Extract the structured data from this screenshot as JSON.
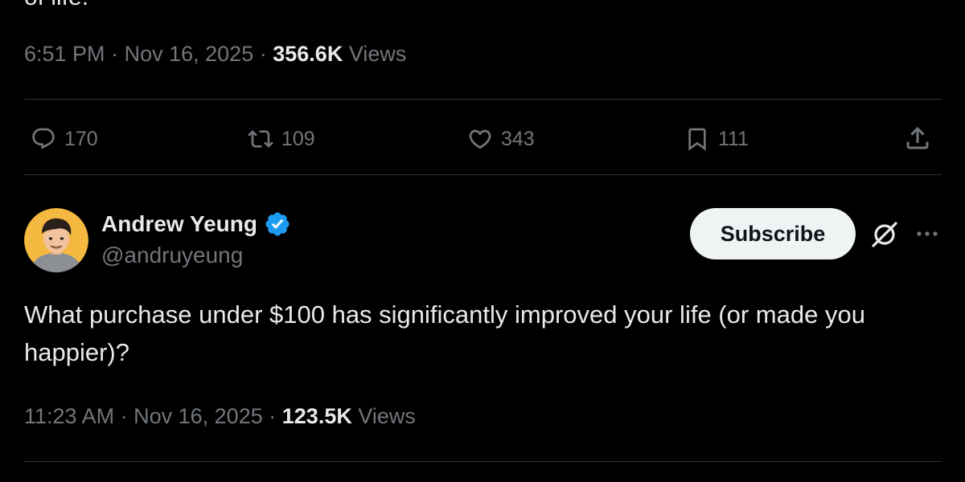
{
  "previous_tweet": {
    "clipped_text": "of life.",
    "time": "6:51 PM",
    "separator": "·",
    "date": "Nov 16, 2025",
    "views_count": "356.6K",
    "views_label": "Views",
    "actions": {
      "reply_count": "170",
      "retweet_count": "109",
      "like_count": "343",
      "bookmark_count": "111"
    }
  },
  "tweet": {
    "author_name": "Andrew Yeung",
    "author_handle": "@andruyeung",
    "subscribe_label": "Subscribe",
    "body": "What purchase under $100 has significantly improved your life (or made you happier)?",
    "time": "11:23 AM",
    "separator": "·",
    "date": "Nov 16, 2025",
    "views_count": "123.5K",
    "views_label": "Views"
  },
  "icons": {
    "reply": "reply-icon",
    "retweet": "retweet-icon",
    "like": "heart-icon",
    "bookmark": "bookmark-icon",
    "share": "share-icon",
    "verified": "verified-badge-icon",
    "grok": "grok-icon",
    "more": "more-icon"
  },
  "colors": {
    "background": "#000000",
    "text_primary": "#e7e9ea",
    "text_secondary": "#71767b",
    "divider": "#2f3336",
    "verified_blue": "#1d9bf0",
    "subscribe_bg": "#eff3f4"
  }
}
